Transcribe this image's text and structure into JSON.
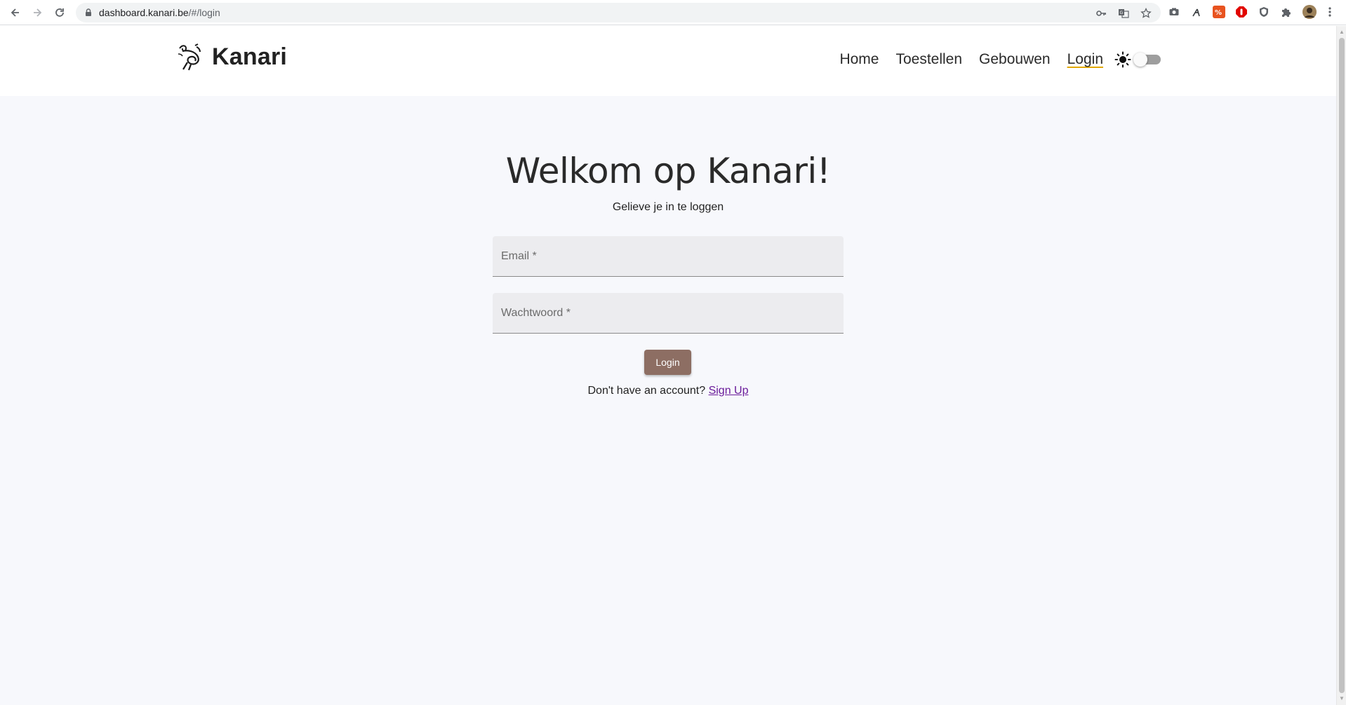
{
  "browser": {
    "url_host": "dashboard.kanari.be",
    "url_path": "/#/login",
    "icons": {
      "back": "arrow-left-icon",
      "forward": "arrow-right-icon",
      "reload": "reload-icon",
      "lock": "lock-icon",
      "password": "key-icon",
      "translate": "translate-icon",
      "bookmark": "star-icon"
    },
    "extension_colors": {
      "honey": "#e8531f",
      "adblock": "#e10600"
    }
  },
  "header": {
    "brand": "Kanari",
    "nav": {
      "home": "Home",
      "toestellen": "Toestellen",
      "gebouwen": "Gebouwen",
      "login": "Login"
    },
    "theme_icon": "sun-icon",
    "dark_mode": false
  },
  "login": {
    "title": "Welkom op Kanari!",
    "subtitle": "Gelieve je in te loggen",
    "email_placeholder": "Email *",
    "password_placeholder": "Wachtwoord *",
    "button": "Login",
    "no_account": "Don't have an account?",
    "signup": "Sign Up"
  },
  "colors": {
    "accent": "#8d6e63",
    "link": "#6a1b9a",
    "active_underline": "#e2a800",
    "background": "#f7f8fc"
  }
}
